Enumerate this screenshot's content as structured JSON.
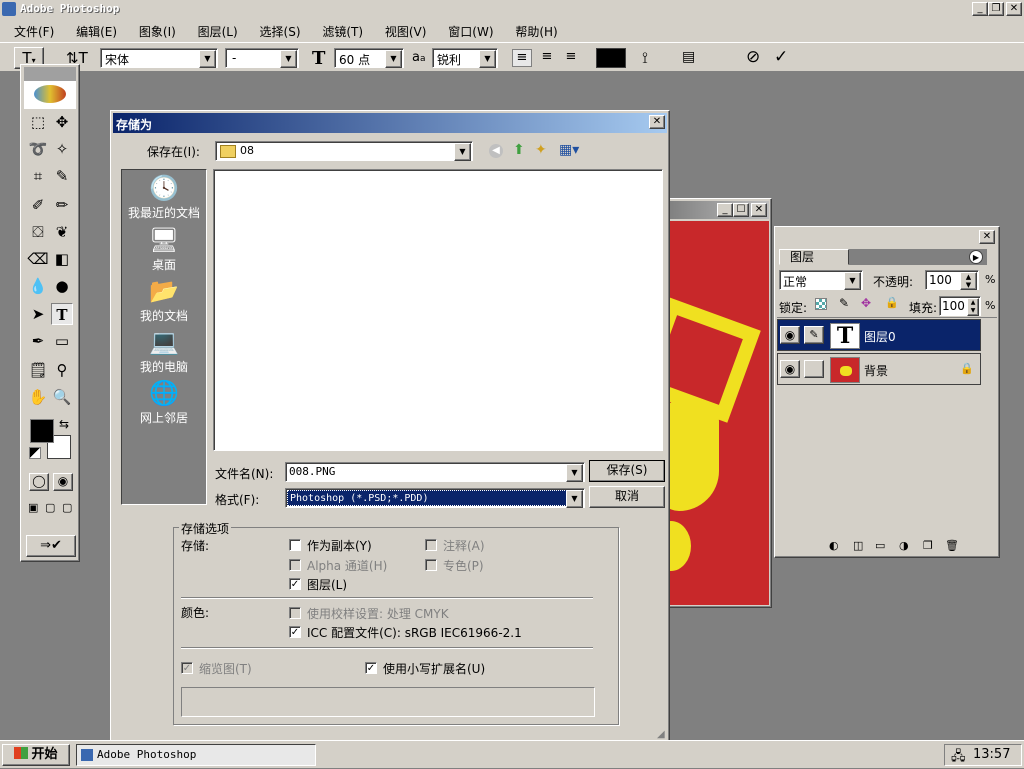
{
  "app": {
    "title": "Adobe Photoshop"
  },
  "menu": [
    "文件(F)",
    "编辑(E)",
    "图象(I)",
    "图层(L)",
    "选择(S)",
    "滤镜(T)",
    "视图(V)",
    "窗口(W)",
    "帮助(H)"
  ],
  "options_bar": {
    "font_family": "宋体",
    "font_style": "-",
    "font_size": "60 点",
    "antialias": "锐利",
    "aa_label": "a",
    "text_color": "#000000"
  },
  "dialog": {
    "title": "存储为",
    "save_in_label": "保存在(I):",
    "save_in_value": "08",
    "places": [
      {
        "label": "我最近的文档",
        "icon": "recent-documents-icon"
      },
      {
        "label": "桌面",
        "icon": "desktop-icon"
      },
      {
        "label": "我的文档",
        "icon": "my-documents-icon"
      },
      {
        "label": "我的电脑",
        "icon": "my-computer-icon"
      },
      {
        "label": "网上邻居",
        "icon": "network-places-icon"
      }
    ],
    "filename_label": "文件名(N):",
    "filename_value": "008.PNG",
    "format_label": "格式(F):",
    "format_value": "Photoshop (*.PSD;*.PDD)",
    "save_button": "保存(S)",
    "cancel_button": "取消",
    "options_group": "存储选项",
    "save_label": "存储:",
    "as_copy": "作为副本(Y)",
    "annotations": "注释(A)",
    "alpha_channels": "Alpha 通道(H)",
    "spot_colors": "专色(P)",
    "layers": "图层(L)",
    "color_label": "颜色:",
    "use_proof": "使用校样设置: 处理 CMYK",
    "icc_profile": "ICC 配置文件(C): sRGB IEC61966-2.1",
    "thumbnail": "缩览图(T)",
    "lowercase_ext": "使用小写扩展名(U)"
  },
  "layers_panel": {
    "tab": "图层",
    "blend_mode": "正常",
    "opacity_label": "不透明:",
    "opacity_value": "100",
    "percent": "%",
    "lock_label": "锁定:",
    "fill_label": "填充:",
    "fill_value": "100",
    "layers": [
      {
        "name": "图层0",
        "thumb": "T",
        "selected": true
      },
      {
        "name": "背景",
        "thumb": "",
        "selected": false
      }
    ]
  },
  "taskbar": {
    "start": "开始",
    "task": "Adobe Photoshop",
    "time": "13:57"
  },
  "colors": {
    "canvas_red": "#c8282a",
    "canvas_yellow": "#f0e020",
    "selection": "#0a246a"
  }
}
